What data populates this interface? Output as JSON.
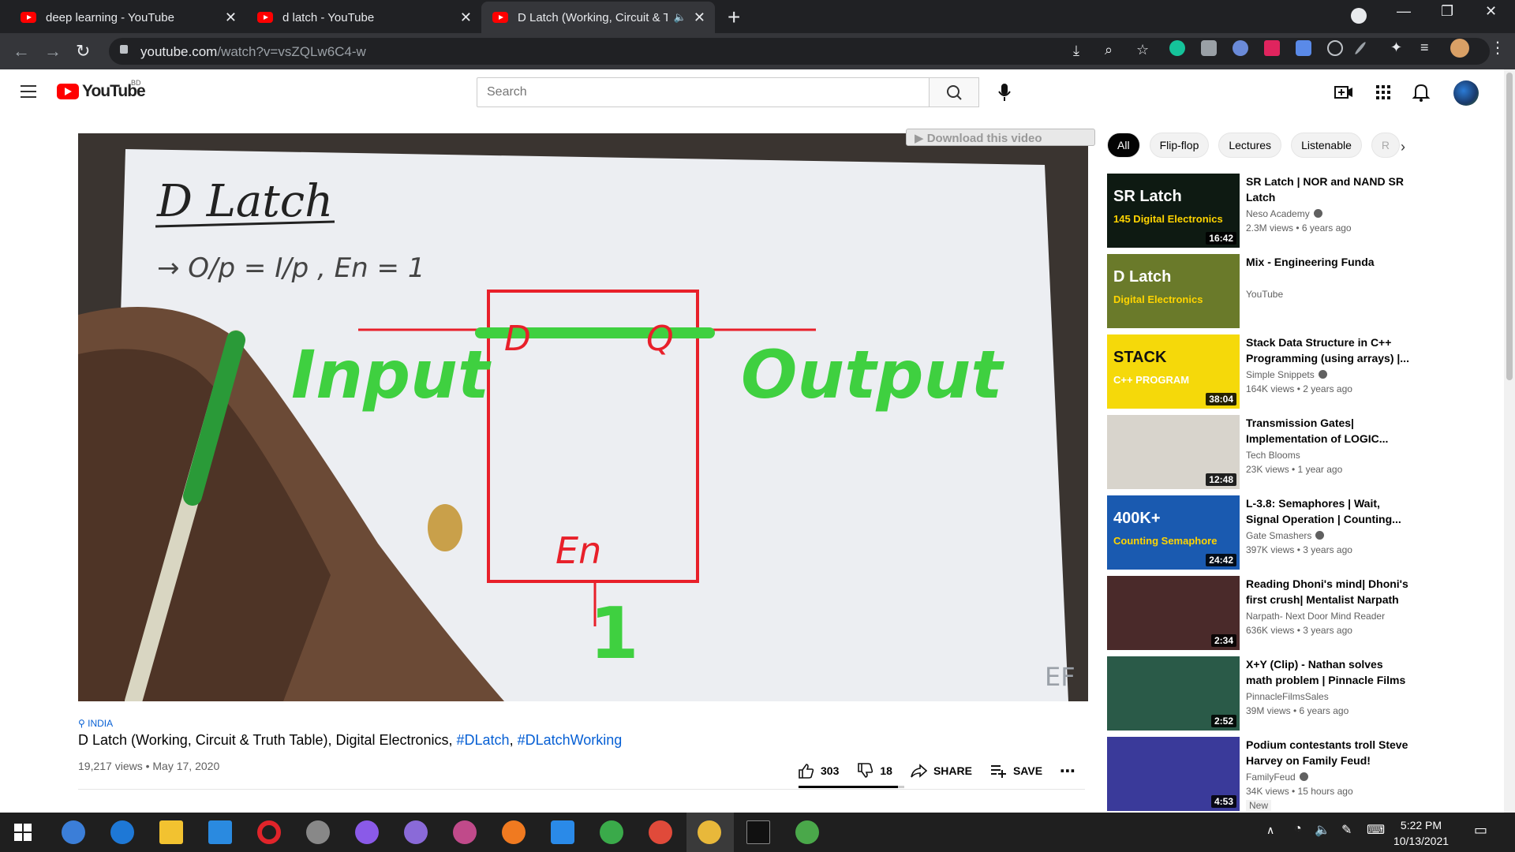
{
  "browser": {
    "tabs": [
      {
        "label": "deep learning - YouTube",
        "active": false
      },
      {
        "label": "d latch - YouTube",
        "active": false
      },
      {
        "label": "D Latch (Working, Circuit & T",
        "active": true
      }
    ],
    "url_host": "youtube.com",
    "url_path": "/watch?v=vsZQLw6C4-w"
  },
  "header": {
    "logo_text": "YouTube",
    "country": "BD",
    "search_placeholder": "Search"
  },
  "video": {
    "download_label": "▶ Download this video",
    "board": {
      "title": "D Latch",
      "note": "→ O/p = I/p , En = 1",
      "d_label": "D",
      "q_label": "Q",
      "input_word": "Input",
      "output_word": "Output",
      "en_label": "En",
      "en_value": "1",
      "watermark": "EF"
    },
    "location": "INDIA",
    "title_main": "D Latch (Working, Circuit & Truth Table), Digital Electronics, ",
    "title_tag1": "#DLatch",
    "title_sep": ", ",
    "title_tag2": "#DLatchWorking",
    "views_date": "19,217 views • May 17, 2020",
    "likes": "303",
    "dislikes": "18",
    "share_label": "SHARE",
    "save_label": "SAVE",
    "like_ratio": 0.944
  },
  "chips": [
    "All",
    "Flip-flop",
    "Lectures",
    "Listenable",
    "R"
  ],
  "recommendations": [
    {
      "title": "SR Latch | NOR and NAND SR Latch",
      "channel": "Neso Academy",
      "verified": true,
      "stats": "2.3M views • 6 years ago",
      "duration": "16:42",
      "thumb_text": "SR Latch",
      "thumb_sub": "145 Digital Electronics",
      "thumb_bg": "#0e1a12"
    },
    {
      "title": "Mix - Engineering Funda",
      "channel": "YouTube",
      "verified": false,
      "stats": "",
      "duration": "",
      "thumb_text": "D Latch",
      "thumb_sub": "Digital Electronics",
      "thumb_bg": "#6a7a2a"
    },
    {
      "title": "Stack Data Structure in C++ Programming (using arrays) |...",
      "channel": "Simple Snippets",
      "verified": true,
      "stats": "164K views • 2 years ago",
      "duration": "38:04",
      "thumb_text": "STACK",
      "thumb_sub": "C++ PROGRAM",
      "thumb_bg": "#f5d90a"
    },
    {
      "title": "Transmission Gates| Implementation of LOGIC...",
      "channel": "Tech Blooms",
      "verified": false,
      "stats": "23K views • 1 year ago",
      "duration": "12:48",
      "thumb_text": "",
      "thumb_sub": "",
      "thumb_bg": "#d8d4cc"
    },
    {
      "title": "L-3.8: Semaphores | Wait, Signal Operation | Counting...",
      "channel": "Gate Smashers",
      "verified": true,
      "stats": "397K views • 3 years ago",
      "duration": "24:42",
      "thumb_text": "400K+",
      "thumb_sub": "Counting Semaphore",
      "thumb_bg": "#1a5ab0"
    },
    {
      "title": "Reading Dhoni's mind| Dhoni's first crush| Mentalist Narpath",
      "channel": "Narpath- Next Door Mind Reader",
      "verified": false,
      "stats": "636K views • 3 years ago",
      "duration": "2:34",
      "thumb_text": "",
      "thumb_sub": "",
      "thumb_bg": "#4a2a2a"
    },
    {
      "title": "X+Y (Clip) - Nathan solves math problem | Pinnacle Films",
      "channel": "PinnacleFilmsSales",
      "verified": false,
      "stats": "39M views • 6 years ago",
      "duration": "2:52",
      "thumb_text": "",
      "thumb_sub": "",
      "thumb_bg": "#2a5a48"
    },
    {
      "title": "Podium contestants troll Steve Harvey on Family Feud!",
      "channel": "FamilyFeud",
      "verified": true,
      "stats": "34K views • 15 hours ago",
      "duration": "4:53",
      "thumb_text": "",
      "thumb_sub": "",
      "thumb_bg": "#3a3a9a",
      "badge": "New"
    }
  ],
  "taskbar": {
    "time": "5:22 PM",
    "date": "10/13/2021"
  },
  "colors": {
    "yt_red": "#ff0000",
    "link_blue": "#065fd4",
    "chrome_dark": "#202124",
    "marker_red": "#e8202a",
    "marker_green": "#3fd040"
  }
}
